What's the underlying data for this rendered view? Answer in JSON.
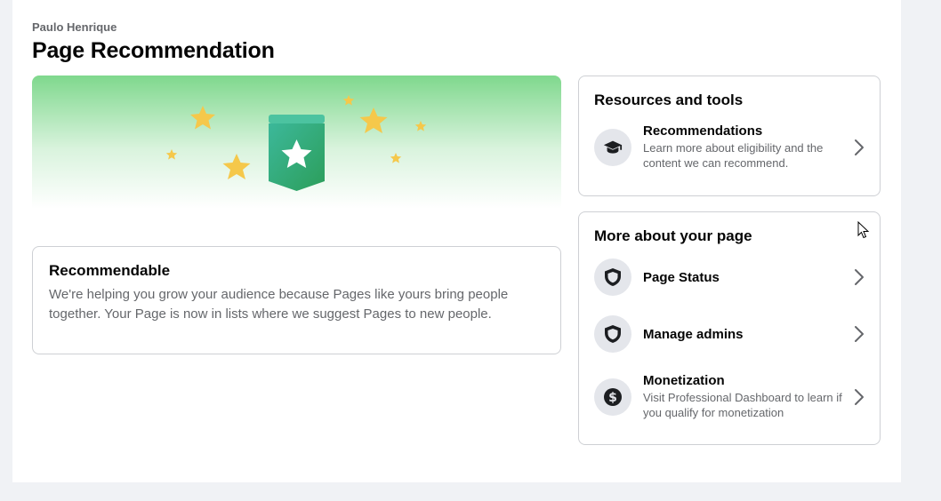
{
  "header": {
    "owner_name": "Paulo Henrique",
    "page_title": "Page Recommendation"
  },
  "hero": {
    "gradient_color": "#7fd88d",
    "badge_color": "#2ea66a",
    "star_color": "#f5c84b"
  },
  "recommendable": {
    "title": "Recommendable",
    "description": "We're helping you grow your audience because Pages like yours bring people together. Your Page is now in lists where we suggest Pages to new people."
  },
  "resources": {
    "title": "Resources and tools",
    "items": [
      {
        "icon": "graduation-cap-icon",
        "label": "Recommendations",
        "description": "Learn more about eligibility and the content we can recommend."
      }
    ]
  },
  "more_about": {
    "title": "More about your page",
    "items": [
      {
        "icon": "shield-icon",
        "label": "Page Status"
      },
      {
        "icon": "shield-icon",
        "label": "Manage admins"
      },
      {
        "icon": "dollar-icon",
        "label": "Monetization",
        "description": "Visit Professional Dashboard to learn if you qualify for monetization"
      }
    ]
  }
}
